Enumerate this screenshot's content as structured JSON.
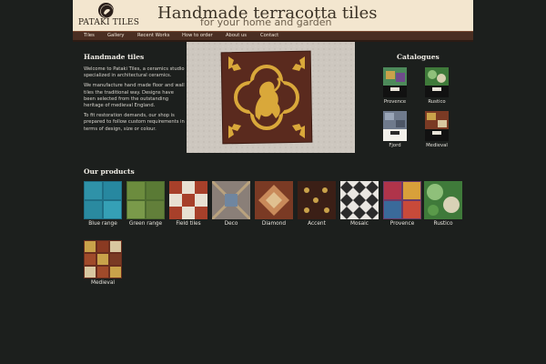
{
  "header": {
    "logo_text": "PATAKI TILES",
    "title": "Handmade terracotta tiles",
    "subtitle": "for your home and garden"
  },
  "nav": {
    "items": [
      {
        "label": "Tiles"
      },
      {
        "label": "Gallery"
      },
      {
        "label": "Recent Works"
      },
      {
        "label": "How to order"
      },
      {
        "label": "About us"
      },
      {
        "label": "Contact"
      }
    ]
  },
  "intro": {
    "heading": "Handmade tiles",
    "paragraphs": [
      "Welcome to Pataki Tiles, a ceramics studio specialized in architectural ceramics.",
      "We manufacture hand made floor and wall tiles the traditional way. Designs have been selected from the outstanding heritage of medieval England.",
      "To fit restoration demands, our shop is prepared to follow custom requirements in terms of design, size or colour."
    ]
  },
  "catalogues": {
    "heading": "Catalogues",
    "items": [
      {
        "label": "Provence"
      },
      {
        "label": "Rustico"
      },
      {
        "label": "Fjord"
      },
      {
        "label": "Medieval"
      }
    ]
  },
  "products": {
    "heading": "Our products",
    "items": [
      {
        "label": "Blue range"
      },
      {
        "label": "Green range"
      },
      {
        "label": "Field tiles"
      },
      {
        "label": "Deco"
      },
      {
        "label": "Diamond"
      },
      {
        "label": "Accent"
      },
      {
        "label": "Mosaic"
      },
      {
        "label": "Provence"
      },
      {
        "label": "Rustico"
      },
      {
        "label": "Medieval"
      }
    ]
  },
  "colors": {
    "background": "#1c1f1d",
    "header_bg": "#f3e6cf",
    "nav_bg": "#4a2e22",
    "text": "#e6e3dc"
  }
}
